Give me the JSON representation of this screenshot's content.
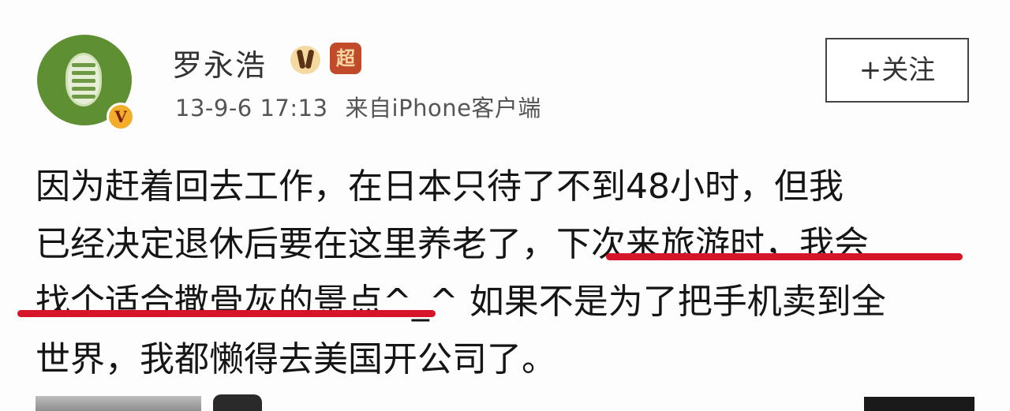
{
  "post": {
    "author": {
      "name": "罗永浩",
      "verified_badge": "V",
      "badge_icons": [
        "vip-medal-icon",
        "member-stamp-icon"
      ],
      "stamp_glyph": "超"
    },
    "date": "13-9-6",
    "time": "17:13",
    "source": "来自iPhone客户端",
    "follow_label": "+关注",
    "content_lines": [
      "因为赶着回去工作，在日本只待了不到48小时，但我",
      "已经决定退休后要在这里养老了，下次来旅游时，我会",
      "找个适合撒骨灰的景点^_^ 如果不是为了把手机卖到全",
      "世界，我都懒得去美国开公司了。"
    ]
  },
  "colors": {
    "avatar_green": "#5f8f33",
    "verified_gold": "#f2ae2a",
    "underline_red": "#d6152a",
    "text": "#151515"
  }
}
